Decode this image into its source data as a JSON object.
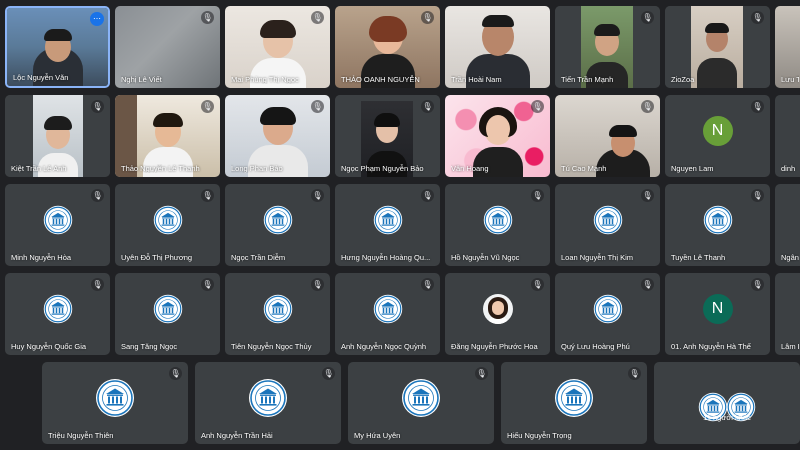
{
  "colors": {
    "background": "#202124",
    "tile": "#3c4043",
    "active_border": "#8ab4f8",
    "avatar_green": "#188038",
    "avatar_teal": "#0b6b57"
  },
  "row1": [
    {
      "name": "Lộc Nguyễn Văn",
      "state": "active-speaker",
      "icon": "more-options-icon"
    },
    {
      "name": "Nghị Lê Viết",
      "icon": "mic-off-icon"
    },
    {
      "name": "Mai Phùng Thị Ngọc",
      "icon": "mic-off-icon"
    },
    {
      "name": "THẢO OANH NGUYỄN",
      "icon": "mic-off-icon"
    },
    {
      "name": "Trần Hoài Nam",
      "icon": "mic-off-icon"
    },
    {
      "name": "Tiến Trần Mạnh",
      "icon": "mic-off-icon"
    },
    {
      "name": "ZioZoa",
      "icon": "mic-off-icon"
    },
    {
      "name": "Lưu Th",
      "icon": "mic-off-icon"
    }
  ],
  "row2": [
    {
      "name": "Kiệt Trần Lê Anh"
    },
    {
      "name": "Thảo Nguyễn Lê Thanh"
    },
    {
      "name": "Long Phan Bảo"
    },
    {
      "name": "Ngọc Phạm Nguyễn Bảo"
    },
    {
      "name": "Vân Hoang"
    },
    {
      "name": "Tú Cao Mạnh"
    },
    {
      "name": "Nguyen Lam",
      "avatar_letter": "N"
    },
    {
      "name": "dinh"
    }
  ],
  "row3": [
    {
      "name": "Minh Nguyễn Hòa"
    },
    {
      "name": "Uyên Đỗ Thị Phương"
    },
    {
      "name": "Ngọc Trần Diễm"
    },
    {
      "name": "Hưng Nguyễn Hoàng Qu..."
    },
    {
      "name": "Hồ Nguyễn Vũ Ngọc"
    },
    {
      "name": "Loan Nguyễn Thị Kim"
    },
    {
      "name": "Tuyền Lê Thanh"
    },
    {
      "name": "Ngân"
    }
  ],
  "row4": [
    {
      "name": "Huy Nguyễn Quốc Gia"
    },
    {
      "name": "Sang Tăng Ngọc"
    },
    {
      "name": "Tiên Nguyễn Ngọc Thủy"
    },
    {
      "name": "Anh Nguyễn Ngọc Quỳnh"
    },
    {
      "name": "Đăng Nguyễn Phước Hoa"
    },
    {
      "name": "Quý Lưu Hoàng Phú"
    },
    {
      "name": "01. Anh Nguyễn Hà Thế",
      "avatar_letter": "N"
    },
    {
      "name": "Lâm L"
    }
  ],
  "row5": [
    {
      "name": "Triệu Nguyễn Thiên"
    },
    {
      "name": "Anh Nguyễn Trần Hải"
    },
    {
      "name": "My Hứa Uyên"
    },
    {
      "name": "Hiếu Nguyễn Trọng"
    }
  ],
  "others_label": "11 người khác"
}
